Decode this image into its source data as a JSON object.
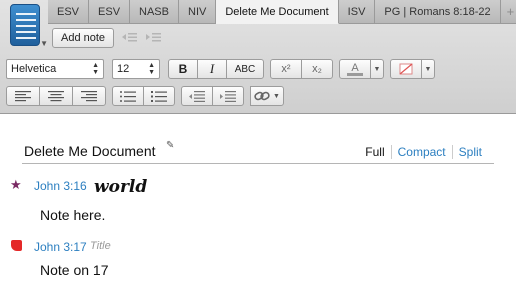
{
  "tabs": [
    {
      "label": "ESV",
      "active": false
    },
    {
      "label": "ESV",
      "active": false
    },
    {
      "label": "NASB",
      "active": false
    },
    {
      "label": "NIV",
      "active": false
    },
    {
      "label": "Delete Me Document",
      "active": true
    },
    {
      "label": "ISV",
      "active": false
    },
    {
      "label": "PG | Romans 8:18-22",
      "active": false
    }
  ],
  "new_tab_label": "+",
  "tab_overflow_label": "»",
  "toolbar": {
    "add_note_label": "Add note",
    "font_family": "Helvetica",
    "font_size": "12",
    "bold_label": "B",
    "italic_label": "I",
    "smallcaps_label": "ABC",
    "superscript_label": "x²",
    "subscript_label": "x₂",
    "text_color_label": "A"
  },
  "document": {
    "title": "Delete Me Document",
    "views": [
      "Full",
      "Compact",
      "Split"
    ],
    "notes": [
      {
        "marker": "star",
        "reference": "John 3:16",
        "title": "world",
        "body": "Note here."
      },
      {
        "marker": "flag",
        "reference": "John 3:17",
        "title": "Title",
        "body": "Note on 17"
      }
    ]
  },
  "colors": {
    "link": "#2c7fc0",
    "star_marker": "#7a2a63",
    "flag_marker": "#e42828",
    "app_icon": "#2f78b8"
  }
}
